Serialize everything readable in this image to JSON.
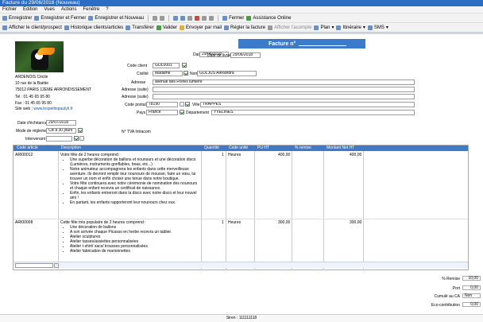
{
  "window": {
    "title": "Facture du 29/06/2018 (Nouveau)"
  },
  "menu": [
    "Fichier",
    "Edition",
    "Vues",
    "Actions",
    "Fenêtre",
    "?"
  ],
  "toolbar": {
    "save": "Enregistrer",
    "save_close": "Enregistrer et Fermer",
    "save_new": "Enregistrer et Nouveau",
    "close": "Fermer",
    "assist": "Assistance Online"
  },
  "toolbar2": {
    "show_client": "Afficher le client/prospect",
    "history": "Historique clients/articles",
    "transfer": "Transférer",
    "validate": "Valider",
    "email": "Envoyer par mail",
    "settle": "Régler la facture",
    "deposit": "Afficher l'acompte",
    "plan": "Plan",
    "itinerary": "Itinéraire",
    "sms": "SMS"
  },
  "invoice": {
    "title": "Facture n°",
    "date_label": "Date",
    "date": "29/06/2018",
    "delivery_label": "Date de livraison",
    "delivery": "29/06/2018"
  },
  "company": {
    "name": "ARDENOIS Cécile",
    "street": "10 rue de la Baëtie",
    "city": "75012     PARIS 12EME ARRONDISSEMENT",
    "tel": "Tel : 01 45 65 95 80",
    "fax": "Fax : 01 45 65 95 80",
    "site_label": "Site web :",
    "site": "www.lespetitspaulyh.fr"
  },
  "client": {
    "code_label": "Code client",
    "code": "GOL0001",
    "civ_label": "Civilité",
    "civ": "Madame",
    "name_label": "Nom",
    "name": "GOLJUS Alexandra",
    "addr_label": "Adresse",
    "addr": "avenue des Frères lumière",
    "addr2_label": "Adresse (suite)",
    "addr3_label": "Adresse (suite)",
    "cp_label": "Code postal",
    "cp": "78190",
    "city_label": "Ville",
    "city": "TRAPPES",
    "country_label": "Pays",
    "country": "France",
    "dept_label": "Département",
    "dept": "YVELINES"
  },
  "terms": {
    "due_label": "Date d'échéance",
    "due": "29/07/2018",
    "mode_label": "Mode de règlement",
    "mode": "CB à 30 jours",
    "int_label": "Intervenant",
    "vat_label": "N° TVA Intracom"
  },
  "grid": {
    "headers": [
      "Code article",
      "Description",
      "Quantité",
      "Code unité",
      "PU HT",
      "% remise",
      "Montant Net HT"
    ],
    "rows": [
      {
        "code": "ARI00012",
        "title": "Votre fête de 2 heures comprend :",
        "items": [
          "Une superbe décoration de ballons et nounours et une décoration disco (Lumières, instruments gonflables, boas, etc...)",
          "Notre animateur accompagnera les enfants dans cette merveilleuse aventure. Ils devront remplir leur nounours de mousse, faire un vœu, lui trouver un nom et enfin choisir une tenue dans notre boutique.",
          "Votre fête continuera avec notre cérémonie de nomination des nounours et chaque enfant recevra un certificat de naissance.",
          "Enfin, les enfants entreront dans la disco avec notre disco et leur nouvel ami !",
          "En partant, les enfants rapporteront leur nounours chez eux."
        ],
        "qty": "1",
        "unit": "Heures",
        "pu": "400,00",
        "total": "400,00"
      },
      {
        "code": "ARI00008",
        "title": "Cette fête très populaire de 2 heures comprend :",
        "items": [
          "Une décoration de ballons",
          "A son arrivée chaque Picasso en herbe recevra un tablier.",
          "Atelier sculptures",
          "Atelier tasses/assiettes personnalisées",
          "Atelier t-shirt/ sacs/ trousses personnalisées",
          "Atelier fabrication de marionnettes"
        ],
        "qty": "1",
        "unit": "Heures",
        "pu": "300,00",
        "total": "300,00"
      }
    ]
  },
  "totals": {
    "remise_label": "% Remise",
    "remise": "10,00",
    "port_label": "Port",
    "port": "0,00",
    "cumul_label": "Cumulé au CA",
    "cumul": "Non",
    "eco_label": "Eco-contribution",
    "eco": "0,00"
  },
  "status": {
    "siren": "Siren : 111111118"
  }
}
